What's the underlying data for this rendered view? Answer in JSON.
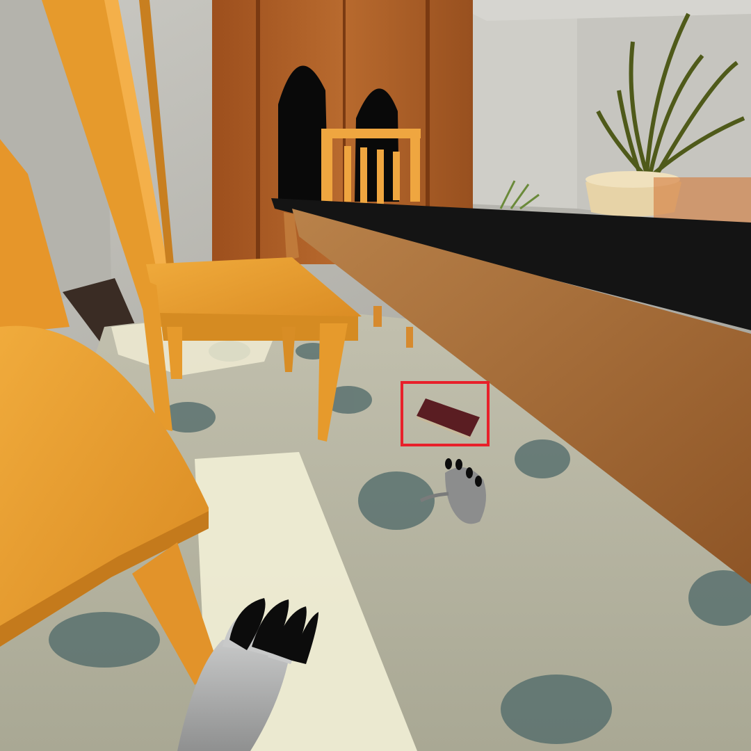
{
  "scene": {
    "view": "first-person",
    "highlight": {
      "target": "rug-item",
      "color": "#e8202a"
    },
    "colors": {
      "wall": "#bdbdb6",
      "carpet": "#b3b19f",
      "carpet_spots": "#4e6868",
      "sunlight": "#f2efd6",
      "chair_wood": "#e39a2f",
      "cabinet_wood": "#a85a24",
      "table_top": "#141414",
      "table_apron": "#a86d36",
      "rug": "#5a1d22",
      "paw_fur": "#a5a6a6",
      "claw_tips": "#0c0c0c"
    }
  }
}
